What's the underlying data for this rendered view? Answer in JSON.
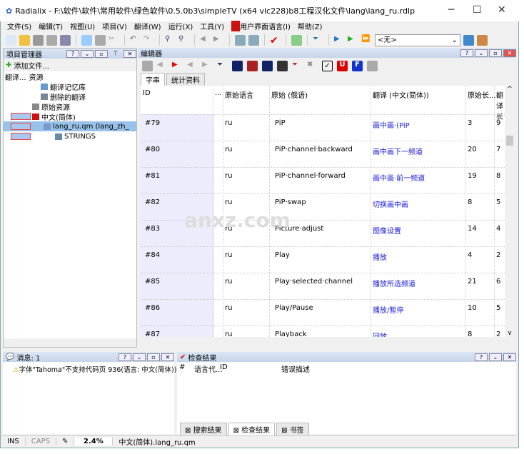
{
  "window": {
    "title": "Radialix - F:\\软件\\软件\\常用软件\\绿色软件\\0.5.0b3\\simpleTV (x64 vlc228)b8工程汉化文件\\lang\\lang_ru.rdlp",
    "minimize": "─",
    "maximize": "☐",
    "close": "✕"
  },
  "menu": [
    "文件(S)",
    "编辑(T)",
    "视图(U)",
    "项目(V)",
    "翻译(W)",
    "运行(X)",
    "工具(Y)",
    "用户界面语言(I)",
    "帮助(Z)"
  ],
  "toolbar": {
    "combo_value": "<无>"
  },
  "project_panel": {
    "title": "项目管理器",
    "add_file": "添加文件...",
    "col1": "翻译...",
    "col2": "资源",
    "tree": [
      "翻译记忆库",
      "删除的翻译",
      "原始资源",
      "中文(简体)",
      "lang_ru.qm (lang_zh_",
      "STRINGS"
    ]
  },
  "editor": {
    "title": "编辑器",
    "tabs": [
      "字串",
      "统计资料"
    ],
    "columns": [
      "ID",
      "...",
      "原始语言",
      "原始 (俄语)",
      "翻译 (中文(简体))",
      "原始长...",
      "翻译长"
    ],
    "rows": [
      {
        "id": "#79",
        "lang": "ru",
        "orig": "PiP",
        "trans": "画中画·(PiP",
        "olen": "3",
        "tlen": "9"
      },
      {
        "id": "#80",
        "lang": "ru",
        "orig": "PiP·channel·backward",
        "trans": "画中画下一频道",
        "olen": "20",
        "tlen": "7"
      },
      {
        "id": "#81",
        "lang": "ru",
        "orig": "PiP·channel·forward",
        "trans": "画中画·前一频道",
        "olen": "19",
        "tlen": "8"
      },
      {
        "id": "#82",
        "lang": "ru",
        "orig": "PiP·swap",
        "trans": "切换画中画",
        "olen": "8",
        "tlen": "5"
      },
      {
        "id": "#83",
        "lang": "ru",
        "orig": "Picture·adjust",
        "trans": "图像设置",
        "olen": "14",
        "tlen": "4"
      },
      {
        "id": "#84",
        "lang": "ru",
        "orig": "Play",
        "trans": "播放",
        "olen": "4",
        "tlen": "2"
      },
      {
        "id": "#85",
        "lang": "ru",
        "orig": "Play·selected·channel",
        "trans": "播放所选频道",
        "olen": "21",
        "tlen": "6"
      },
      {
        "id": "#86",
        "lang": "ru",
        "orig": "Play/Pause",
        "trans": "播放/暂停",
        "olen": "10",
        "tlen": "5"
      },
      {
        "id": "#87",
        "lang": "ru",
        "orig": "Playback",
        "trans": "回放",
        "olen": "8",
        "tlen": "2"
      }
    ]
  },
  "messages": {
    "title": "消息: 1",
    "item": "字体\"Tahoma\"不支持代码页 936(语言: 中文(简体))"
  },
  "check": {
    "title": "检查结果",
    "columns": [
      "#",
      "语言代...",
      "ID",
      "错误描述"
    ],
    "tabs": [
      "搜索结果",
      "检查结果",
      "书签"
    ]
  },
  "status": {
    "ins": "INS",
    "caps": "CAPS",
    "percent": "2.4%",
    "file": "中文(简体).lang_ru.qm"
  },
  "watermark": "anxz.com"
}
